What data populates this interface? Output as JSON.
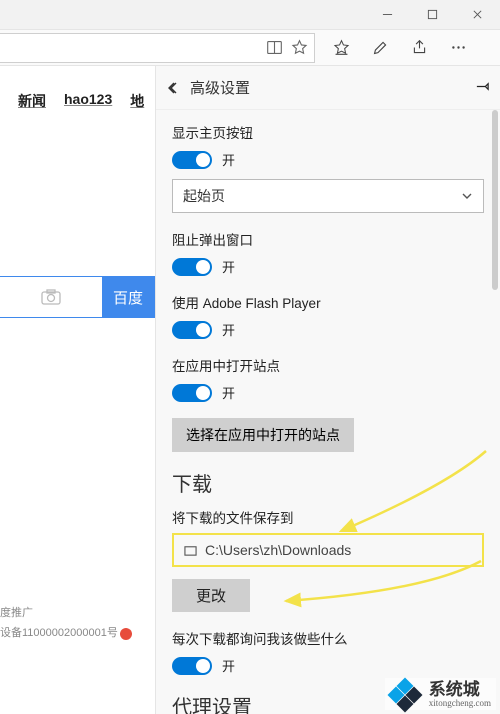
{
  "titlebar": {
    "minimize": "minimize",
    "maximize": "maximize",
    "close": "close"
  },
  "toolbar": {
    "reading_icon": "reading-view",
    "star_icon": "favorite",
    "favorites_icon": "favorites-list",
    "pen_icon": "web-note",
    "share_icon": "share",
    "more_icon": "more"
  },
  "page_links": {
    "news": "新闻",
    "hao123": "hao123",
    "extra": "地"
  },
  "search": {
    "baidu_btn": "百度"
  },
  "promo": {
    "line1": "度推广",
    "line2": "设备11000002000001号"
  },
  "panel": {
    "title": "高级设置",
    "settings": {
      "show_home": {
        "label": "显示主页按钮",
        "state": "开"
      },
      "start_select": "起始页",
      "block_popup": {
        "label": "阻止弹出窗口",
        "state": "开"
      },
      "flash": {
        "label": "使用 Adobe Flash Player",
        "state": "开"
      },
      "app_open": {
        "label": "在应用中打开站点",
        "state": "开"
      },
      "app_open_btn": "选择在应用中打开的站点",
      "download_title": "下载",
      "download_save_label": "将下载的文件保存到",
      "download_path": "C:\\Users\\zh\\Downloads",
      "change_btn": "更改",
      "ask_every": {
        "label": "每次下载都询问我该做些什么",
        "state": "开"
      },
      "proxy_title": "代理设置"
    }
  },
  "watermark": {
    "name": "系统城",
    "url": "xitongcheng.com"
  }
}
